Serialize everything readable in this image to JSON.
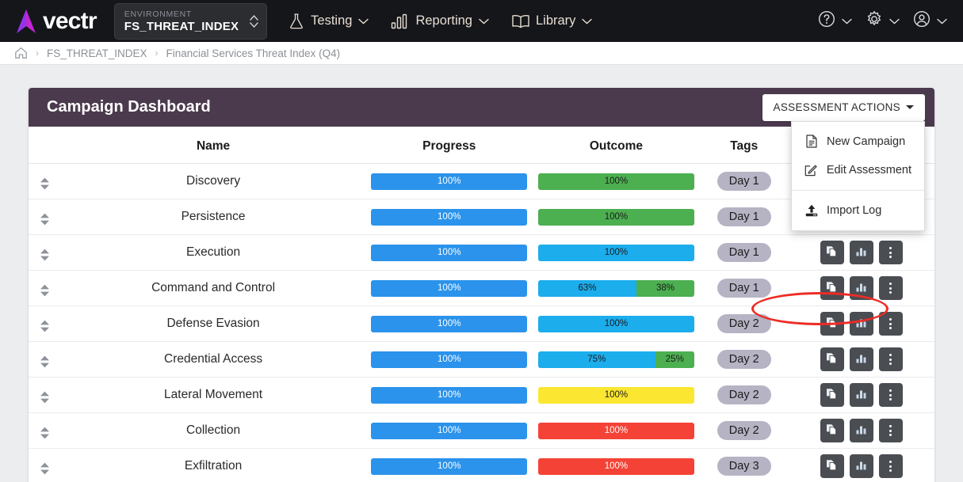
{
  "topnav": {
    "brand_name": "vectr",
    "environment_caption": "ENVIRONMENT",
    "environment_value": "FS_THREAT_INDEX",
    "nav_items": [
      {
        "label": "Testing",
        "icon": "flask-icon"
      },
      {
        "label": "Reporting",
        "icon": "bar-chart-icon"
      },
      {
        "label": "Library",
        "icon": "book-icon"
      }
    ],
    "right_icons": [
      {
        "name": "help-icon"
      },
      {
        "name": "gear-icon"
      },
      {
        "name": "account-icon"
      }
    ]
  },
  "breadcrumb": {
    "home_icon": "home-icon",
    "items": [
      {
        "label": "FS_THREAT_INDEX"
      },
      {
        "label": "Financial Services Threat Index (Q4)"
      }
    ],
    "separator": "›"
  },
  "card": {
    "title": "Campaign Dashboard",
    "actions_button_label": "ASSESSMENT ACTIONS",
    "dropdown": {
      "open": true,
      "items": [
        {
          "label": "New Campaign",
          "icon": "file-icon"
        },
        {
          "label": "Edit Assessment",
          "icon": "edit-icon"
        },
        {
          "label": "Import Log",
          "icon": "upload-icon",
          "highlighted": true
        }
      ]
    },
    "annotation": {
      "shape": "ellipse",
      "color": "#ee2b25",
      "target": "Import Log"
    }
  },
  "table": {
    "headers": [
      "",
      "Name",
      "Progress",
      "Outcome",
      "Tags",
      ""
    ],
    "rows": [
      {
        "name": "Discovery",
        "progress": [
          {
            "label": "100%",
            "color": "blue",
            "pct": 100
          }
        ],
        "outcome": [
          {
            "label": "100%",
            "color": "green",
            "pct": 100
          }
        ],
        "tag": "Day 1"
      },
      {
        "name": "Persistence",
        "progress": [
          {
            "label": "100%",
            "color": "blue",
            "pct": 100
          }
        ],
        "outcome": [
          {
            "label": "100%",
            "color": "green",
            "pct": 100
          }
        ],
        "tag": "Day 1"
      },
      {
        "name": "Execution",
        "progress": [
          {
            "label": "100%",
            "color": "blue",
            "pct": 100
          }
        ],
        "outcome": [
          {
            "label": "100%",
            "color": "cyan",
            "pct": 100
          }
        ],
        "tag": "Day 1"
      },
      {
        "name": "Command and Control",
        "progress": [
          {
            "label": "100%",
            "color": "blue",
            "pct": 100
          }
        ],
        "outcome": [
          {
            "label": "63%",
            "color": "cyan",
            "pct": 63
          },
          {
            "label": "38%",
            "color": "green",
            "pct": 37
          }
        ],
        "tag": "Day 1"
      },
      {
        "name": "Defense Evasion",
        "progress": [
          {
            "label": "100%",
            "color": "blue",
            "pct": 100
          }
        ],
        "outcome": [
          {
            "label": "100%",
            "color": "cyan",
            "pct": 100
          }
        ],
        "tag": "Day 2"
      },
      {
        "name": "Credential Access",
        "progress": [
          {
            "label": "100%",
            "color": "blue",
            "pct": 100
          }
        ],
        "outcome": [
          {
            "label": "75%",
            "color": "cyan",
            "pct": 75
          },
          {
            "label": "25%",
            "color": "green",
            "pct": 25
          }
        ],
        "tag": "Day 2"
      },
      {
        "name": "Lateral Movement",
        "progress": [
          {
            "label": "100%",
            "color": "blue",
            "pct": 100
          }
        ],
        "outcome": [
          {
            "label": "100%",
            "color": "yellow",
            "pct": 100
          }
        ],
        "tag": "Day 2"
      },
      {
        "name": "Collection",
        "progress": [
          {
            "label": "100%",
            "color": "blue",
            "pct": 100
          }
        ],
        "outcome": [
          {
            "label": "100%",
            "color": "red",
            "pct": 100
          }
        ],
        "tag": "Day 2"
      },
      {
        "name": "Exfiltration",
        "progress": [
          {
            "label": "100%",
            "color": "blue",
            "pct": 100
          }
        ],
        "outcome": [
          {
            "label": "100%",
            "color": "red",
            "pct": 100
          }
        ],
        "tag": "Day 3"
      }
    ],
    "row_actions": [
      {
        "name": "copy-campaign-button",
        "icon": "copy-icon"
      },
      {
        "name": "view-chart-button",
        "icon": "bar-chart-icon"
      },
      {
        "name": "more-options-button",
        "icon": "kebab-icon"
      }
    ]
  },
  "colors": {
    "nav_bg": "#14161a",
    "card_header": "#4b3a4d",
    "page_bg": "#ebedef",
    "progress_blue": "#2b93eb",
    "outcome_cyan": "#1cadec",
    "outcome_green": "#4caf50",
    "outcome_yellow": "#fbe731",
    "outcome_red": "#f44336",
    "tag_pill": "#b6b3c4",
    "action_button": "#4a4d52",
    "annotation_red": "#ee2b25"
  }
}
